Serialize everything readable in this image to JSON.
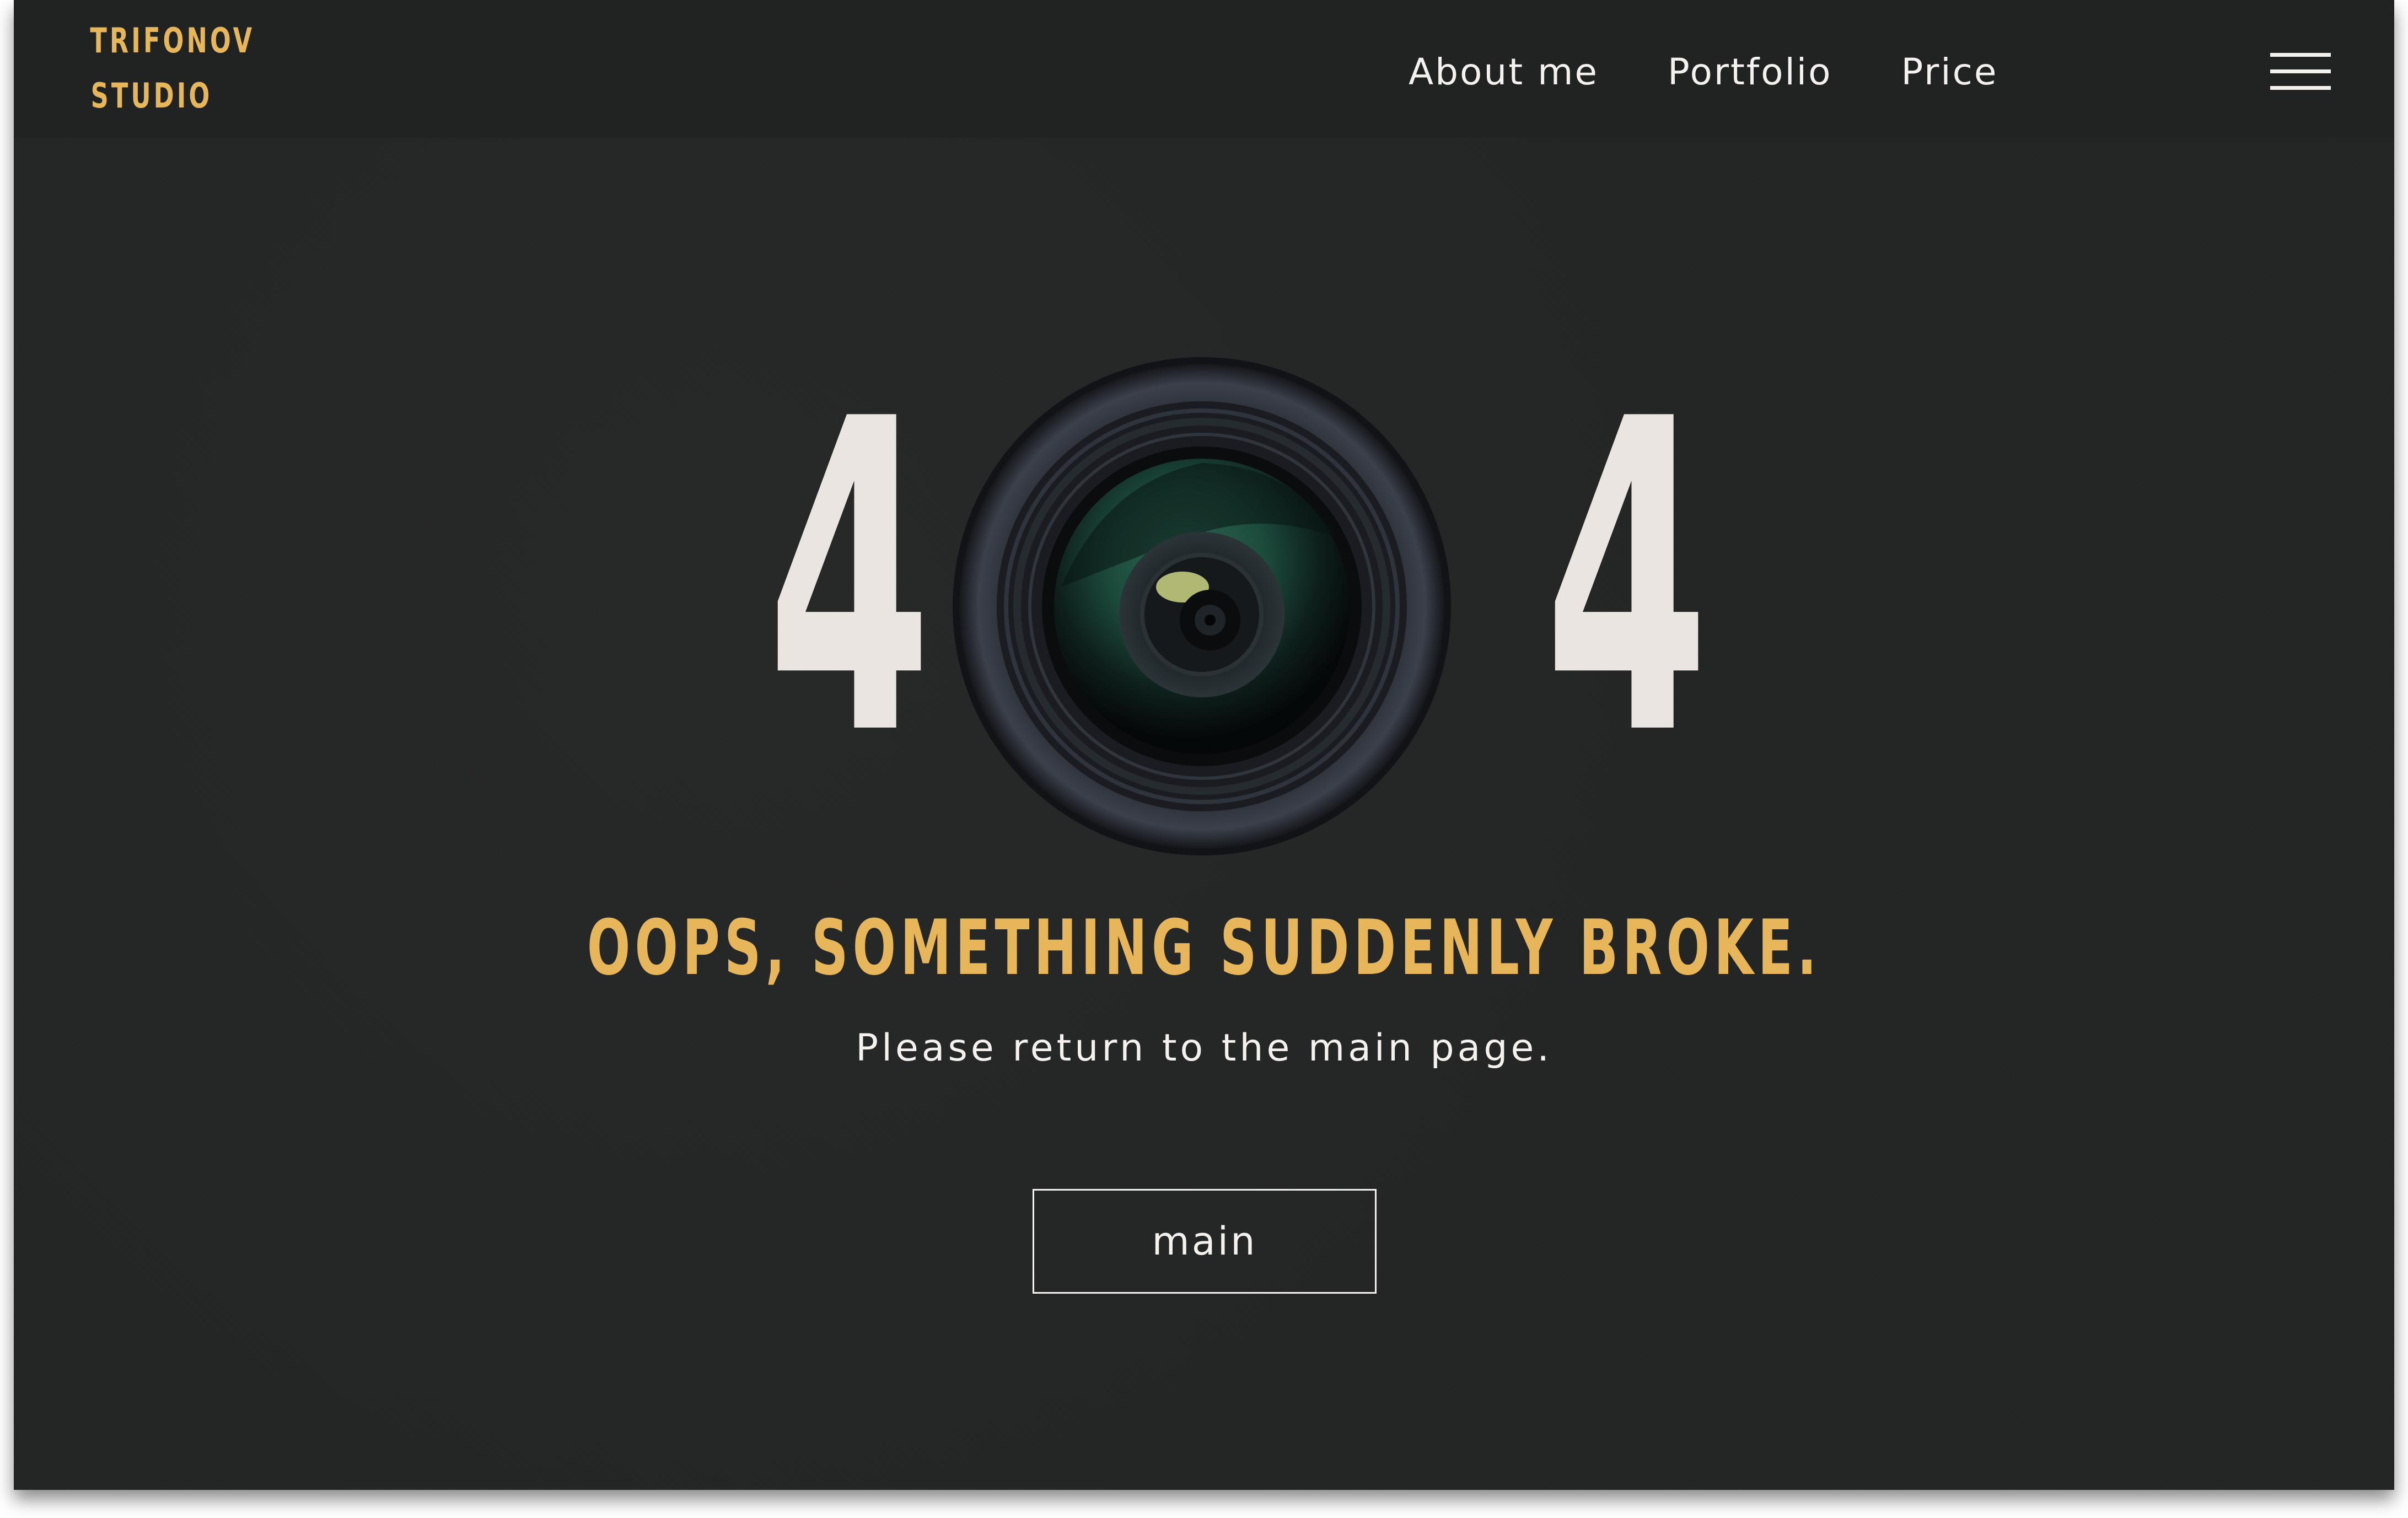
{
  "header": {
    "logo_line1": "TRIFONOV",
    "logo_line2": "STUDIO",
    "nav": [
      {
        "label": "About me"
      },
      {
        "label": "Portfolio"
      },
      {
        "label": "Price"
      }
    ],
    "menu_icon": "hamburger-menu-icon"
  },
  "error": {
    "digit_left": "4",
    "digit_right": "4",
    "center_image": "camera-lens",
    "headline": "OOPS, SOMETHING SUDDENLY BROKE.",
    "message": "Please return to the main page.",
    "button_label": "main"
  },
  "colors": {
    "background": "#232424",
    "header_background": "#212222",
    "accent": "#e8b65a",
    "text": "#f4f1ee",
    "digit": "#ebe5e1"
  }
}
